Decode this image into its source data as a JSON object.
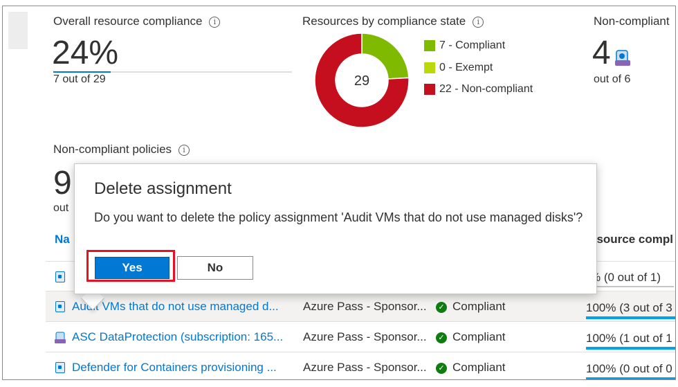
{
  "summary": {
    "overall_title": "Overall resource compliance",
    "overall_value": "24%",
    "overall_sub": "7 out of 29",
    "state_title": "Resources by compliance state",
    "donut_center": "29",
    "legend": [
      {
        "label": "7 - Compliant",
        "color": "#7fba00"
      },
      {
        "label": "0 - Exempt",
        "color": "#bad80a"
      },
      {
        "label": "22 - Non-compliant",
        "color": "#c50f1f"
      }
    ],
    "noncompliant_title": "Non-compliant",
    "noncompliant_value": "4",
    "noncompliant_sub": "out of 6",
    "policies_title": "Non-compliant policies",
    "policies_value": "9",
    "policies_sub": "out"
  },
  "chart_data": {
    "type": "pie",
    "categories": [
      "Compliant",
      "Exempt",
      "Non-compliant"
    ],
    "values": [
      7,
      0,
      22
    ],
    "colors": [
      "#7fba00",
      "#bad80a",
      "#c50f1f"
    ],
    "center_label": "29"
  },
  "table": {
    "col_name": "Na",
    "col_compliance": "esource compl",
    "rows": [
      {
        "name": "",
        "scope": "",
        "state": "",
        "percent": "% (0 out of 1)"
      },
      {
        "name": "Audit VMs that do not use managed d...",
        "scope": "Azure Pass - Sponsor...",
        "state": "Compliant",
        "percent": "100% (3 out of 3"
      },
      {
        "name": "ASC DataProtection (subscription: 165...",
        "scope": "Azure Pass - Sponsor...",
        "state": "Compliant",
        "percent": "100% (1 out of 1"
      },
      {
        "name": "Defender for Containers provisioning ...",
        "scope": "Azure Pass - Sponsor...",
        "state": "Compliant",
        "percent": "100% (0 out of 0"
      }
    ]
  },
  "dialog": {
    "title": "Delete assignment",
    "message": "Do you want to delete the policy assignment 'Audit VMs that do not use managed disks'?",
    "yes_label": "Yes",
    "no_label": "No"
  }
}
